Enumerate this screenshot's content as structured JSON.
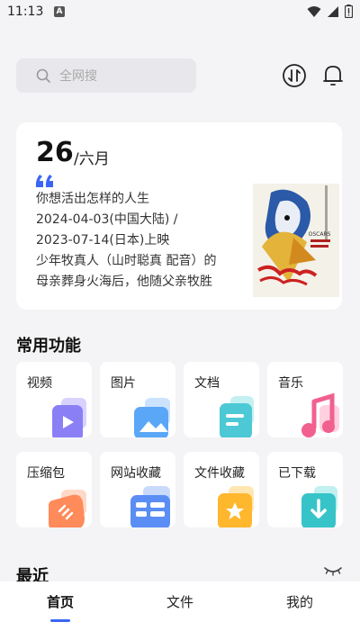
{
  "status": {
    "time": "11:13",
    "notif_letter": "A"
  },
  "header": {
    "search_placeholder": "全网搜"
  },
  "daily": {
    "day": "26",
    "month": "/六月",
    "lines": [
      "你想活出怎样的人生",
      "2024-04-03(中国大陆) /",
      "2023-07-14(日本)上映",
      "少年牧真人（山时聪真 配音）的",
      "母亲葬身火海后，他随父亲牧胜"
    ],
    "poster_label": "OSCARS"
  },
  "sections": {
    "common": "常用功能",
    "recent": "最近"
  },
  "tiles": [
    {
      "label": "视频",
      "icon": "video-icon",
      "color": "#8b7ff5"
    },
    {
      "label": "图片",
      "icon": "image-icon",
      "color": "#5aa6f7"
    },
    {
      "label": "文档",
      "icon": "document-icon",
      "color": "#4dc9d6"
    },
    {
      "label": "音乐",
      "icon": "music-icon",
      "color": "#f2608f"
    },
    {
      "label": "压缩包",
      "icon": "archive-icon",
      "color": "#ff8a5a"
    },
    {
      "label": "网站收藏",
      "icon": "website-bookmark-icon",
      "color": "#5b8ef5"
    },
    {
      "label": "文件收藏",
      "icon": "file-bookmark-icon",
      "color": "#ffb72e"
    },
    {
      "label": "已下载",
      "icon": "download-icon",
      "color": "#37c4c8"
    }
  ],
  "nav": {
    "home": "首页",
    "files": "文件",
    "mine": "我的"
  },
  "colors": {
    "accent": "#3b66f5",
    "background": "#f4f4f6"
  }
}
